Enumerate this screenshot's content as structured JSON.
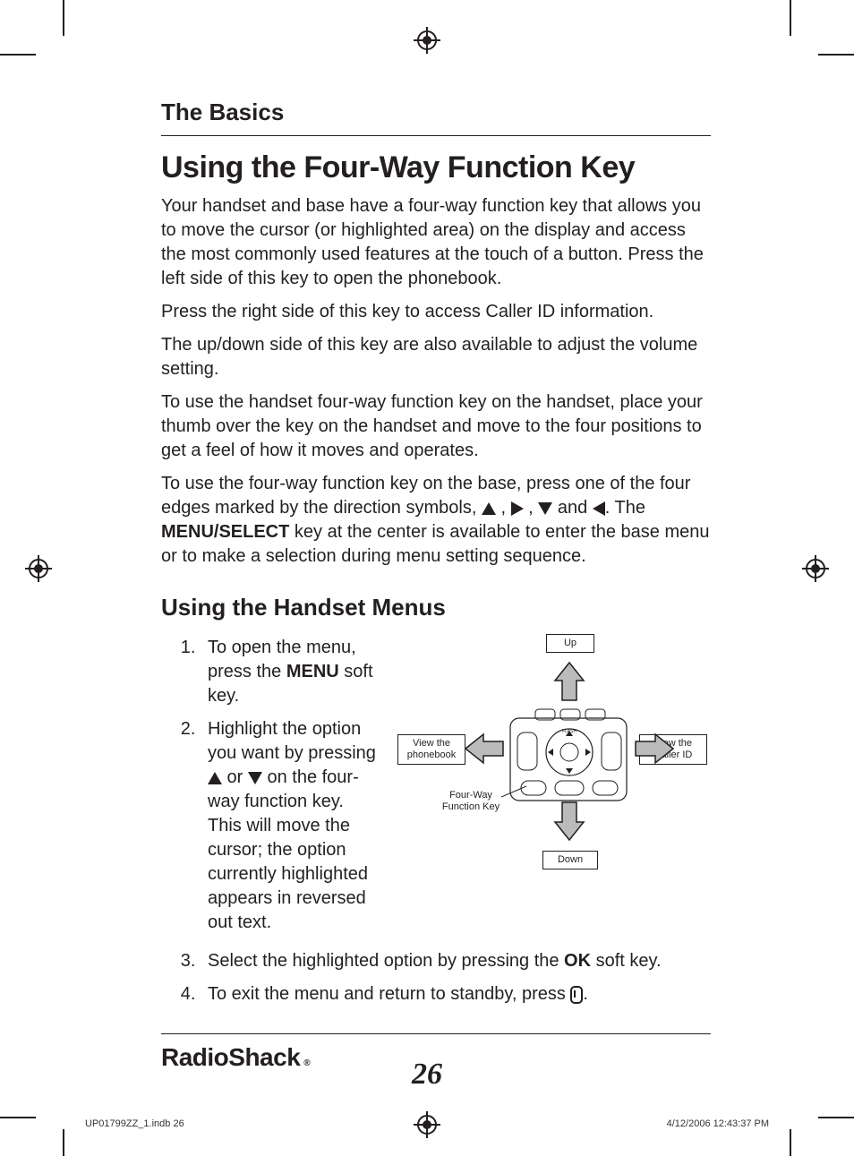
{
  "section_header": "The Basics",
  "title": "Using the Four-Way Function Key",
  "paragraphs": {
    "p1": "Your handset and base have a four-way function key that allows you to move the cursor (or highlighted area) on the display and access the most commonly used features at the touch of a button. Press the left side of this key to open the phonebook.",
    "p2": "Press the right side of this key to access Caller ID information.",
    "p3": "The up/down side of this key are also available to adjust the volume setting.",
    "p4": "To use the handset four-way function key on the handset, place your thumb over the key on the handset and move to the four positions to get a feel of how it moves and operates.",
    "p5a": "To use the four-way function key on the base, press one of the four edges marked by the direction symbols, ",
    "p5b": " , ",
    "p5c": " , ",
    "p5d": " and ",
    "p5e": ". The ",
    "p5_key": "MENU/SELECT",
    "p5f": " key at the center is available to enter the base menu or to make a selection during menu setting sequence."
  },
  "subheading": "Using the Handset Menus",
  "steps": {
    "s1a": "To open the menu, press the ",
    "s1_key": "MENU",
    "s1b": " soft key.",
    "s2a": "Highlight the option you want by pressing ",
    "s2b": " or ",
    "s2c": " on the four-way function key. This will move the cursor; the option currently highlighted appears in reversed out text.",
    "s3a": "Select the highlighted option by pressing the ",
    "s3_key": "OK",
    "s3b": " soft key.",
    "s4a": "To exit the menu and return to standby, press ",
    "s4b": "."
  },
  "diagram": {
    "up": "Up",
    "down": "Down",
    "left": "View the phonebook",
    "right": "View the Caller ID",
    "label": "Four-Way Function Key"
  },
  "brand": "RadioShack",
  "page_number": "26",
  "footer": {
    "left": "UP01799ZZ_1.indb   26",
    "right": "4/12/2006   12:43:37 PM"
  }
}
